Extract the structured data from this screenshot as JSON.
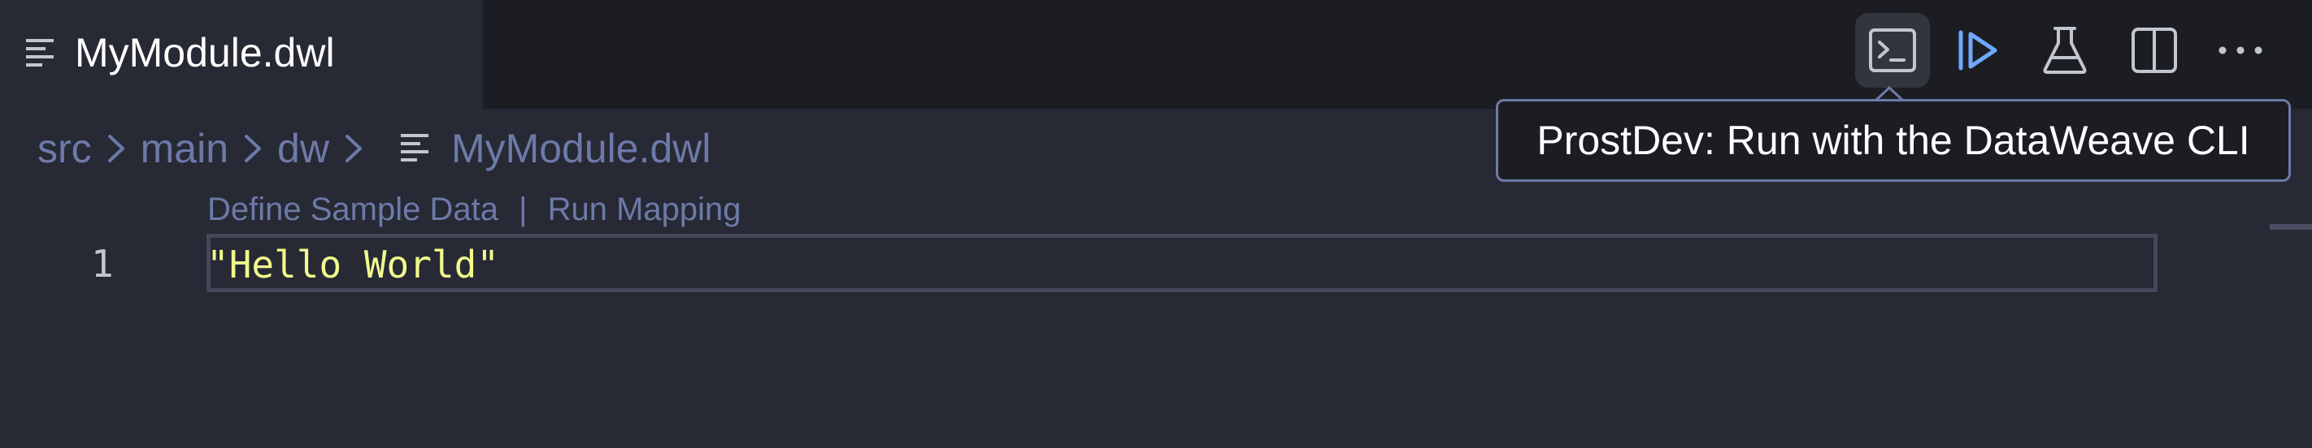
{
  "tab": {
    "title": "MyModule.dwl",
    "icon": "file-lines-icon"
  },
  "toolbar": {
    "terminal_button": {
      "icon": "terminal-icon",
      "active": true
    },
    "run_button": {
      "icon": "run-debug-icon",
      "color": "#6ea8ff"
    },
    "test_button": {
      "icon": "flask-icon"
    },
    "split_button": {
      "icon": "split-editor-icon"
    },
    "more_button": {
      "icon": "ellipsis-icon"
    }
  },
  "breadcrumb": {
    "items": [
      "src",
      "main",
      "dw"
    ],
    "file": "MyModule.dwl"
  },
  "codelens": {
    "define_sample_data": "Define Sample Data",
    "separator": "|",
    "run_mapping": "Run Mapping"
  },
  "editor": {
    "line_number": "1",
    "code": "\"Hello World\""
  },
  "tooltip": {
    "text": "ProstDev: Run with the DataWeave CLI"
  },
  "colors": {
    "background": "#272935",
    "tabbar": "#1c1d23",
    "breadcrumb_text": "#6d7aa8",
    "string": "#f1fa8c",
    "accent_blue": "#6ea8ff"
  }
}
